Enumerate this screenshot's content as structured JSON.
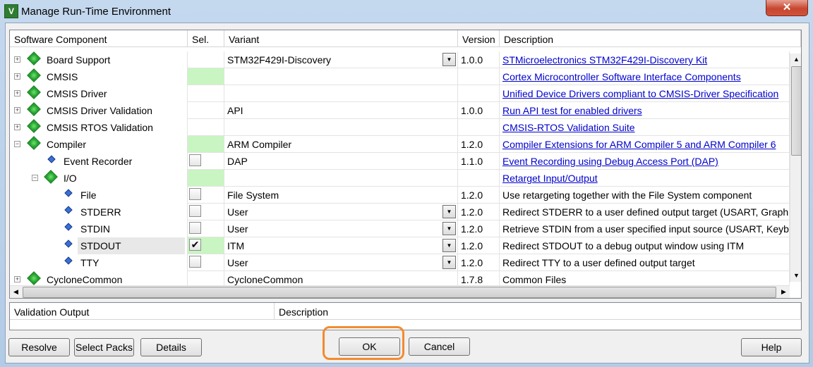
{
  "title": "Manage Run-Time Environment",
  "app_icon_letter": "V",
  "close_glyph": "✕",
  "columns": {
    "component": "Software Component",
    "sel": "Sel.",
    "variant": "Variant",
    "version": "Version",
    "description": "Description"
  },
  "rows": [
    {
      "name": "Board Support",
      "variant": "STM32F429I-Discovery",
      "version": "1.0.0",
      "description": "STMicroelectronics STM32F429I-Discovery Kit"
    },
    {
      "name": "CMSIS",
      "variant": "",
      "version": "",
      "description": "Cortex Microcontroller Software Interface Components"
    },
    {
      "name": "CMSIS Driver",
      "variant": "",
      "version": "",
      "description": "Unified Device Drivers compliant to CMSIS-Driver Specification"
    },
    {
      "name": "CMSIS Driver Validation",
      "variant": "API",
      "version": "1.0.0",
      "description": "Run API test for enabled drivers"
    },
    {
      "name": "CMSIS RTOS Validation",
      "variant": "",
      "version": "",
      "description": "CMSIS-RTOS Validation Suite"
    },
    {
      "name": "Compiler",
      "variant": "ARM Compiler",
      "version": "1.2.0",
      "description": "Compiler Extensions for ARM Compiler 5 and ARM Compiler 6"
    },
    {
      "name": "Event Recorder",
      "variant": "DAP",
      "version": "1.1.0",
      "description": "Event Recording using Debug Access Port (DAP)"
    },
    {
      "name": "I/O",
      "variant": "",
      "version": "",
      "description": "Retarget Input/Output"
    },
    {
      "name": "File",
      "variant": "File System",
      "version": "1.2.0",
      "description": "Use retargeting together with the File System component"
    },
    {
      "name": "STDERR",
      "variant": "User",
      "version": "1.2.0",
      "description": "Redirect STDERR to a user defined output target (USART, Graphics Display or other)"
    },
    {
      "name": "STDIN",
      "variant": "User",
      "version": "1.2.0",
      "description": "Retrieve STDIN from a user specified input source  (USART, Keyboard or other)"
    },
    {
      "name": "STDOUT",
      "variant": "ITM",
      "version": "1.2.0",
      "description": "Redirect STDOUT to a debug output window using ITM"
    },
    {
      "name": "TTY",
      "variant": "User",
      "version": "1.2.0",
      "description": "Redirect TTY to a user defined output target"
    },
    {
      "name": "CycloneCommon",
      "variant": "CycloneCommon",
      "version": "1.7.8",
      "description": "Common Files"
    }
  ],
  "validation": {
    "output_header": "Validation Output",
    "description_header": "Description"
  },
  "buttons": {
    "resolve": "Resolve",
    "select_packs": "Select Packs",
    "details": "Details",
    "ok": "OK",
    "cancel": "Cancel",
    "help": "Help"
  },
  "checkmark": "✔",
  "glyphs": {
    "plus": "+",
    "minus": "−",
    "dd": "▼",
    "up": "▲",
    "down": "▼",
    "left": "◀",
    "right": "▶"
  },
  "colors": {
    "highlight": "#f28b30",
    "selected_green": "#c8f5c1",
    "link": "#0000cc"
  }
}
